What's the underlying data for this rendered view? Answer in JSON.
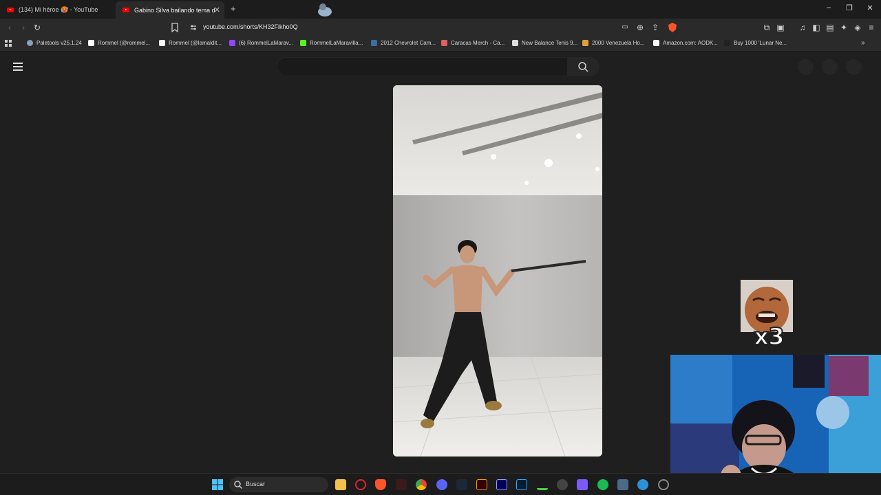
{
  "browser": {
    "tabs": [
      {
        "label": "(134) Mi héroe 🥵 - YouTube",
        "active": false
      },
      {
        "label": "Gabino Silva bailando tema de G",
        "active": true
      }
    ],
    "new_tab_label": "+",
    "address": "youtube.com/shorts/KH32Fikho0Q",
    "window_controls": {
      "minimize": "–",
      "maximize": "❐",
      "close": "✕"
    }
  },
  "bookmarks": [
    {
      "label": "Paletools v25.1.24",
      "icon_color": "#8aa0b8"
    },
    {
      "label": "Rommel (@rommel...",
      "icon_color": "#ffffff"
    },
    {
      "label": "Rommel (@lamaldit...",
      "icon_color": "#ffffff"
    },
    {
      "label": "(6) RommelLaMarav...",
      "icon_color": "#9146ff"
    },
    {
      "label": "RommelLaMaravilla...",
      "icon_color": "#53fc18"
    },
    {
      "label": "2012 Chevrolet Cam...",
      "icon_color": "#3a6ea5"
    },
    {
      "label": "Caracas Merch - Ca...",
      "icon_color": "#e06060"
    },
    {
      "label": "New Balance Tenis 9...",
      "icon_color": "#dddddd"
    },
    {
      "label": "2000 Venezuela Ho...",
      "icon_color": "#e0a040"
    },
    {
      "label": "Amazon.com: AODK...",
      "icon_color": "#ffffff"
    },
    {
      "label": "Buy 1000 'Lunar Ne...",
      "icon_color": "#222222"
    }
  ],
  "overlay": {
    "multiplier": "x3"
  },
  "taskbar": {
    "search_label": "Buscar"
  },
  "colors": {
    "background": "#1f1f1f",
    "accent": "#ff0000"
  }
}
